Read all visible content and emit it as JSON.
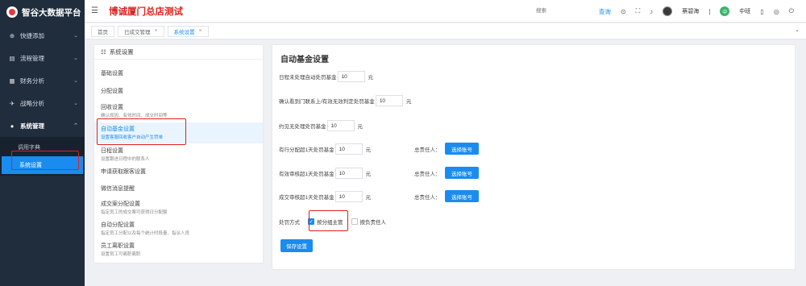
{
  "sidebar": {
    "brand": "智谷大数据平台",
    "menu": [
      {
        "icon": "plus-circle-icon",
        "glyph": "⊕",
        "label": "快捷添加"
      },
      {
        "icon": "flow-icon",
        "glyph": "▤",
        "label": "流程管理"
      },
      {
        "icon": "finance-icon",
        "glyph": "▦",
        "label": "财务分析"
      },
      {
        "icon": "strategy-icon",
        "glyph": "✈",
        "label": "战略分析"
      },
      {
        "icon": "settings-icon",
        "glyph": "●",
        "label": "系统管理"
      }
    ],
    "submenu": [
      "调用字典",
      "系统设置"
    ]
  },
  "header": {
    "store_title": "博诚厦门总店测试",
    "search_placeholder": "搜索",
    "query_label": "查询",
    "user_name": "蔡碧海",
    "shift_badge": "中",
    "shift_label": "中班"
  },
  "tabs": [
    {
      "label": "首页",
      "closable": false
    },
    {
      "label": "已成交管理",
      "closable": true
    },
    {
      "label": "系统设置",
      "closable": true
    }
  ],
  "left_panel": {
    "title": "系统设置",
    "items": [
      {
        "title": "基础设置",
        "sub": ""
      },
      {
        "title": "分配设置",
        "sub": ""
      },
      {
        "title": "回收设置",
        "sub": "确认原因、有效时间、成交时间等"
      },
      {
        "title": "自动基金设置",
        "sub": "设置客服回收客户自动产生罚单"
      },
      {
        "title": "日程设置",
        "sub": "设置跟进日程中的联系人"
      },
      {
        "title": "申请获取跟客设置",
        "sub": ""
      },
      {
        "title": "微信消息提醒",
        "sub": ""
      },
      {
        "title": "成交案分配设置",
        "sub": "指定员工的成交案可获得日分配额"
      },
      {
        "title": "自动分配设置",
        "sub": "指定员工分配以及每个统计时段量、指派人员"
      },
      {
        "title": "员工离职设置",
        "sub": "设置员工可离职离职"
      }
    ]
  },
  "main": {
    "title": "自动基金设置",
    "rows": [
      {
        "label": "日程未处理自动处罚基金",
        "value": "10",
        "unit": "元",
        "responsible": ""
      },
      {
        "label": "确认看到门联系上/有效无效判定处罚基金",
        "value": "10",
        "unit": "元",
        "responsible": ""
      },
      {
        "label": "约见无处理处罚基金",
        "value": "10",
        "unit": "元",
        "responsible": ""
      },
      {
        "label": "有行分配超1天处罚基金",
        "value": "10",
        "unit": "元",
        "responsible": "总责任人："
      },
      {
        "label": "有效审核超1天处罚基金",
        "value": "10",
        "unit": "元",
        "responsible": "总责任人："
      },
      {
        "label": "成交审核超1天处罚基金",
        "value": "10",
        "unit": "元",
        "responsible": "总责任人："
      }
    ],
    "select_button": "选择账号",
    "method_label": "处罚方式",
    "method_options": [
      {
        "label": "按分组主管",
        "checked": true
      },
      {
        "label": "按负责任人",
        "checked": false
      }
    ],
    "save_button": "保存设置"
  }
}
